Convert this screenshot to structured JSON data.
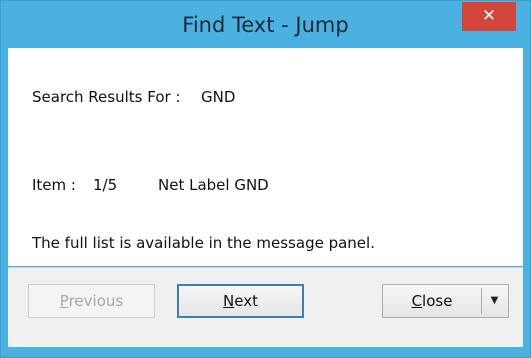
{
  "window": {
    "title": "Find Text - Jump",
    "close_glyph": "✕"
  },
  "content": {
    "search_label": "Search Results For :",
    "search_term": "GND",
    "item_label": "Item :",
    "item_position": "1/5",
    "item_description": "Net Label GND",
    "info_text": "The full list is available in the message panel."
  },
  "buttons": {
    "previous": {
      "mnemonic": "P",
      "rest": "revious",
      "enabled": false
    },
    "next": {
      "mnemonic": "N",
      "rest": "ext",
      "enabled": true,
      "default": true
    },
    "close": {
      "mnemonic": "C",
      "rest": "lose",
      "enabled": true
    },
    "close_dropdown_glyph": "▼"
  },
  "icons": {
    "title_close": "close-icon",
    "dropdown": "chevron-down-icon"
  },
  "colors": {
    "titlebar": "#4bb1e0",
    "close_button": "#d4463a",
    "default_button_border": "#3c7fb1"
  }
}
